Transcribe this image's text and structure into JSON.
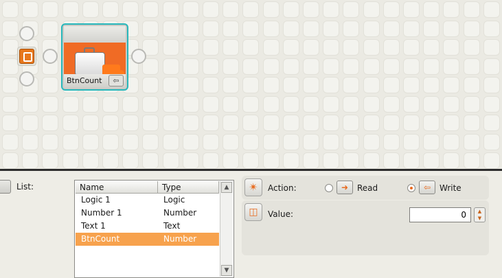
{
  "canvas": {
    "block_label": "BtnCount",
    "block_io_glyph": "⇦"
  },
  "panel": {
    "list_label": "List:",
    "table": {
      "columns": [
        "Name",
        "Type"
      ],
      "rows": [
        {
          "name": "Logic 1",
          "type": "Logic",
          "selected": false
        },
        {
          "name": "Number 1",
          "type": "Number",
          "selected": false
        },
        {
          "name": "Text 1",
          "type": "Text",
          "selected": false
        },
        {
          "name": "BtnCount",
          "type": "Number",
          "selected": true
        }
      ],
      "scroll_up": "▲",
      "scroll_down": "▼"
    },
    "action": {
      "label": "Action:",
      "icon": "star-burst-icon",
      "options": [
        {
          "label": "Read",
          "checked": false,
          "icon": "read-arrow-icon"
        },
        {
          "label": "Write",
          "checked": true,
          "icon": "write-arrow-icon"
        }
      ]
    },
    "value": {
      "label": "Value:",
      "icon": "value-input-icon",
      "current": "0"
    }
  },
  "colors": {
    "accent_orange": "#f06b25",
    "selection": "#f7a24d",
    "block_outline": "#27b7bb"
  }
}
